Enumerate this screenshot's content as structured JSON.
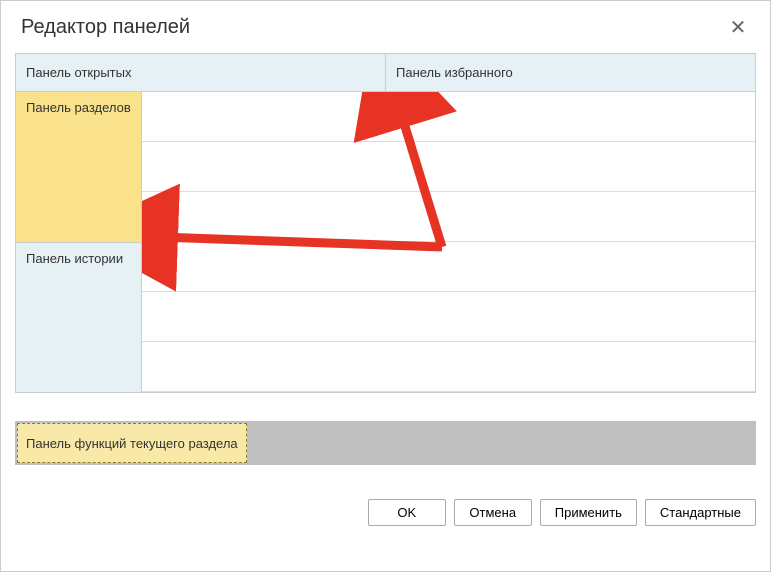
{
  "title": "Редактор панелей",
  "top": {
    "open_panel": "Панель открытых",
    "favorites_panel": "Панель избранного"
  },
  "sidebar": {
    "sections": "Панель разделов",
    "history": "Панель истории"
  },
  "unused": {
    "func_panel": "Панель функций текущего раздела"
  },
  "buttons": {
    "ok": "OK",
    "cancel": "Отмена",
    "apply": "Применить",
    "defaults": "Стандартные"
  },
  "colors": {
    "accent_yellow": "#f9e28b",
    "pale_blue": "#e6f1f5",
    "arrow": "#e73323"
  }
}
